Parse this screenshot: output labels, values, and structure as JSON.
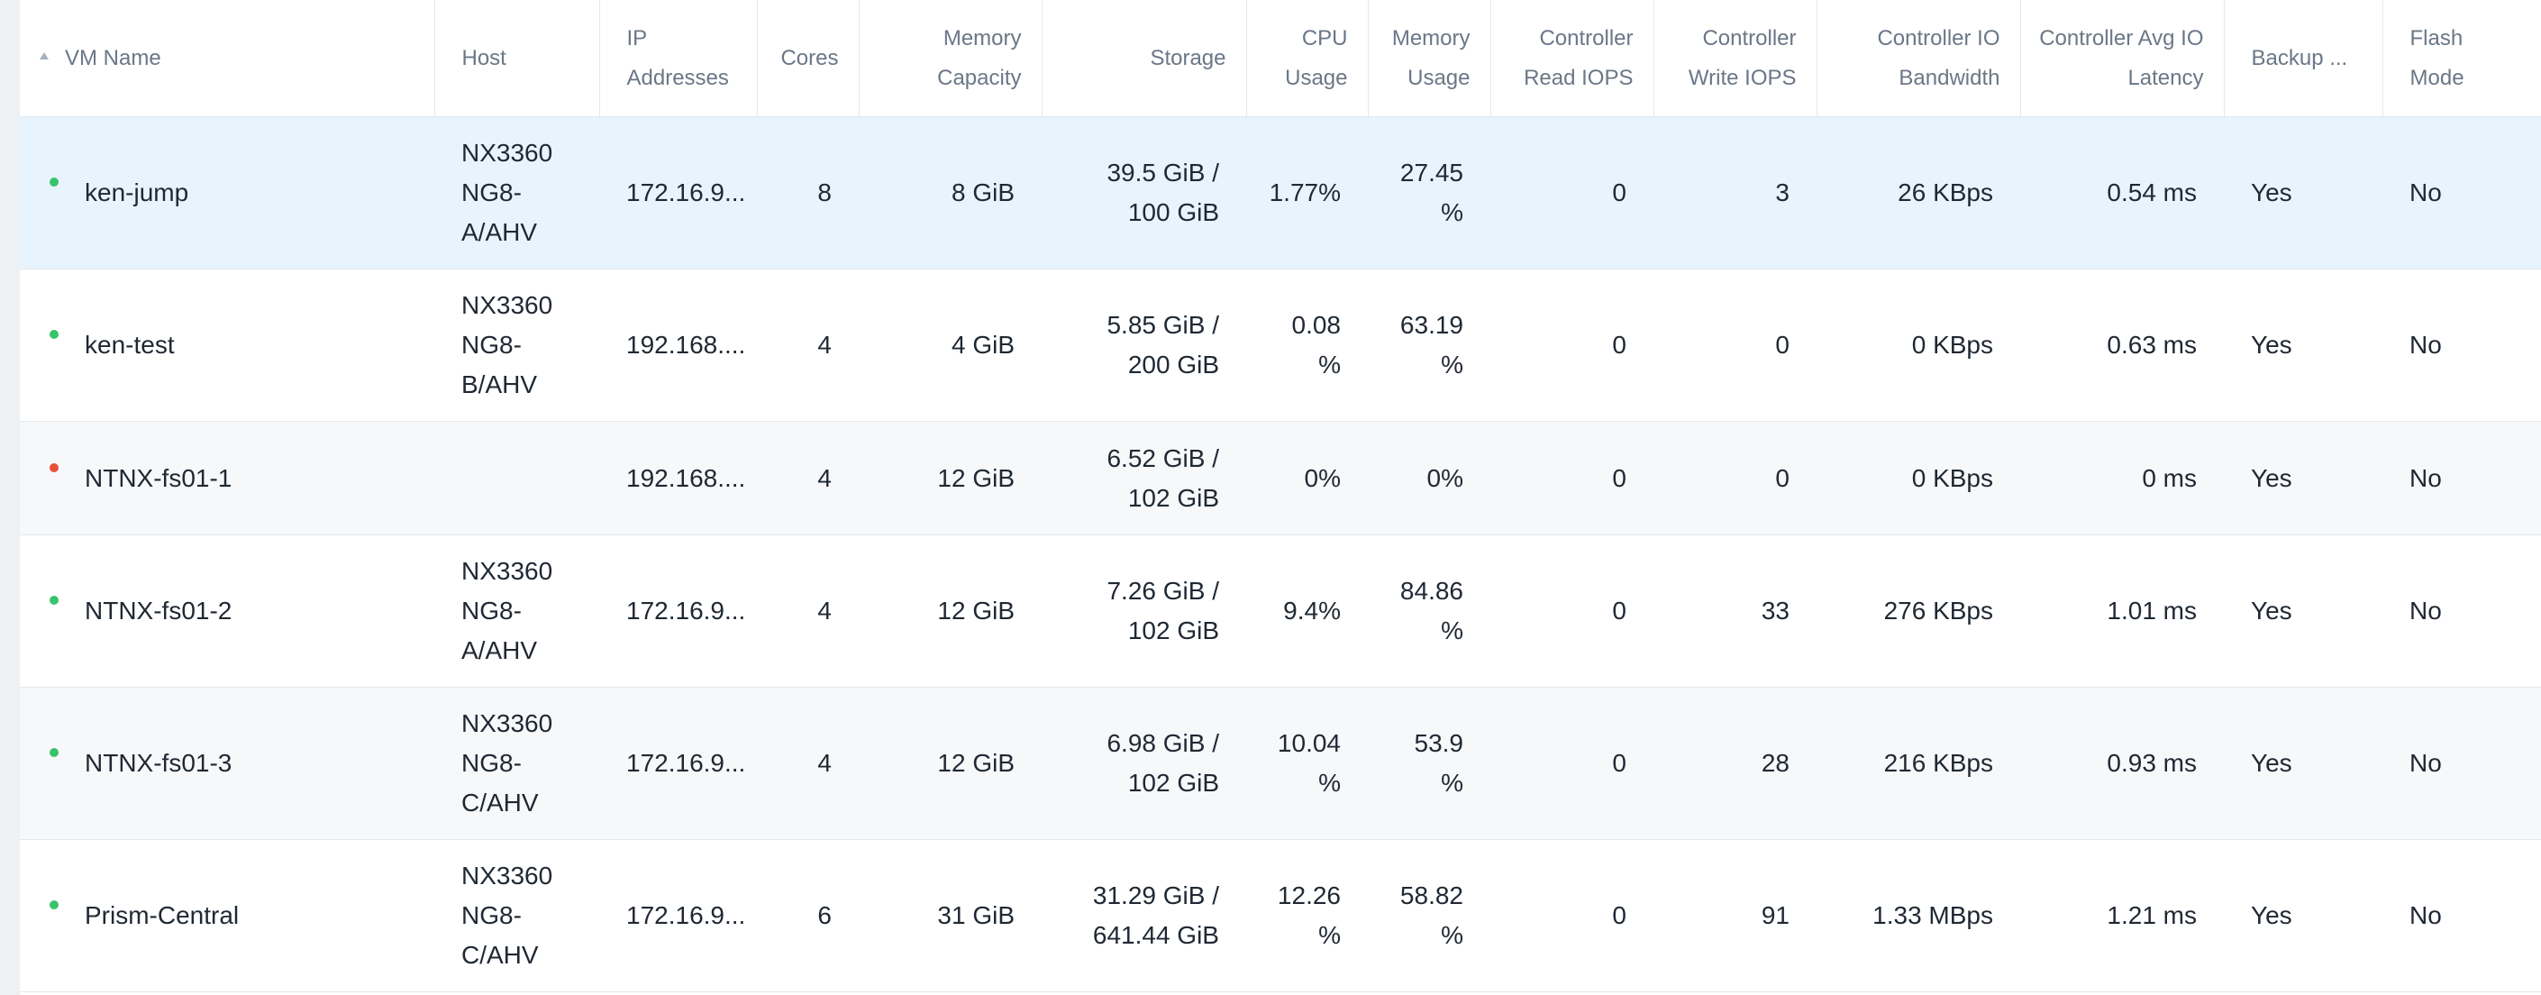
{
  "columns": {
    "vm_name": "VM Name",
    "host": "Host",
    "ip_1": "IP",
    "ip_2": "Addresses",
    "cores": "Cores",
    "mem_cap_1": "Memory",
    "mem_cap_2": "Capacity",
    "storage": "Storage",
    "cpu_1": "CPU",
    "cpu_2": "Usage",
    "mem_use_1": "Memory",
    "mem_use_2": "Usage",
    "read_1": "Controller",
    "read_2": "Read IOPS",
    "write_1": "Controller",
    "write_2": "Write IOPS",
    "bw_1": "Controller IO",
    "bw_2": "Bandwidth",
    "lat_1": "Controller Avg IO",
    "lat_2": "Latency",
    "backup": "Backup ...",
    "flash_1": "Flash",
    "flash_2": "Mode"
  },
  "rows": [
    {
      "status": "ok",
      "name": "ken-jump",
      "host": [
        "NX3360",
        "NG8-",
        "A/AHV"
      ],
      "ip": "172.16.9...",
      "cores": "8",
      "mem_cap": "8 GiB",
      "storage": [
        "39.5 GiB /",
        "100 GiB"
      ],
      "cpu": [
        "1.77%"
      ],
      "mem_use": [
        "27.45",
        "%"
      ],
      "read_iops": "0",
      "write_iops": "3",
      "bandwidth": "26 KBps",
      "latency": "0.54 ms",
      "backup": "Yes",
      "flash": "No"
    },
    {
      "status": "ok",
      "name": "ken-test",
      "host": [
        "NX3360",
        "NG8-",
        "B/AHV"
      ],
      "ip": "192.168....",
      "cores": "4",
      "mem_cap": "4 GiB",
      "storage": [
        "5.85 GiB /",
        "200 GiB"
      ],
      "cpu": [
        "0.08",
        "%"
      ],
      "mem_use": [
        "63.19",
        "%"
      ],
      "read_iops": "0",
      "write_iops": "0",
      "bandwidth": "0 KBps",
      "latency": "0.63 ms",
      "backup": "Yes",
      "flash": "No"
    },
    {
      "status": "err",
      "name": "NTNX-fs01-1",
      "host": [],
      "ip": "192.168....",
      "cores": "4",
      "mem_cap": "12 GiB",
      "storage": [
        "6.52 GiB /",
        "102 GiB"
      ],
      "cpu": [
        "0%"
      ],
      "mem_use": [
        "0%"
      ],
      "read_iops": "0",
      "write_iops": "0",
      "bandwidth": "0 KBps",
      "latency": "0 ms",
      "backup": "Yes",
      "flash": "No"
    },
    {
      "status": "ok",
      "name": "NTNX-fs01-2",
      "host": [
        "NX3360",
        "NG8-",
        "A/AHV"
      ],
      "ip": "172.16.9...",
      "cores": "4",
      "mem_cap": "12 GiB",
      "storage": [
        "7.26 GiB /",
        "102 GiB"
      ],
      "cpu": [
        "9.4%"
      ],
      "mem_use": [
        "84.86",
        "%"
      ],
      "read_iops": "0",
      "write_iops": "33",
      "bandwidth": "276 KBps",
      "latency": "1.01 ms",
      "backup": "Yes",
      "flash": "No"
    },
    {
      "status": "ok",
      "name": "NTNX-fs01-3",
      "host": [
        "NX3360",
        "NG8-",
        "C/AHV"
      ],
      "ip": "172.16.9...",
      "cores": "4",
      "mem_cap": "12 GiB",
      "storage": [
        "6.98 GiB /",
        "102 GiB"
      ],
      "cpu": [
        "10.04",
        "%"
      ],
      "mem_use": [
        "53.9",
        "%"
      ],
      "read_iops": "0",
      "write_iops": "28",
      "bandwidth": "216 KBps",
      "latency": "0.93 ms",
      "backup": "Yes",
      "flash": "No"
    },
    {
      "status": "ok",
      "name": "Prism-Central",
      "host": [
        "NX3360",
        "NG8-",
        "C/AHV"
      ],
      "ip": "172.16.9...",
      "cores": "6",
      "mem_cap": "31 GiB",
      "storage": [
        "31.29 GiB /",
        "641.44 GiB"
      ],
      "cpu": [
        "12.26",
        "%"
      ],
      "mem_use": [
        "58.82",
        "%"
      ],
      "read_iops": "0",
      "write_iops": "91",
      "bandwidth": "1.33 MBps",
      "latency": "1.21 ms",
      "backup": "Yes",
      "flash": "No"
    }
  ],
  "colors": {
    "status_ok": "#36c46b",
    "status_err": "#e8503a",
    "selected_row": "#e8f4fd"
  }
}
